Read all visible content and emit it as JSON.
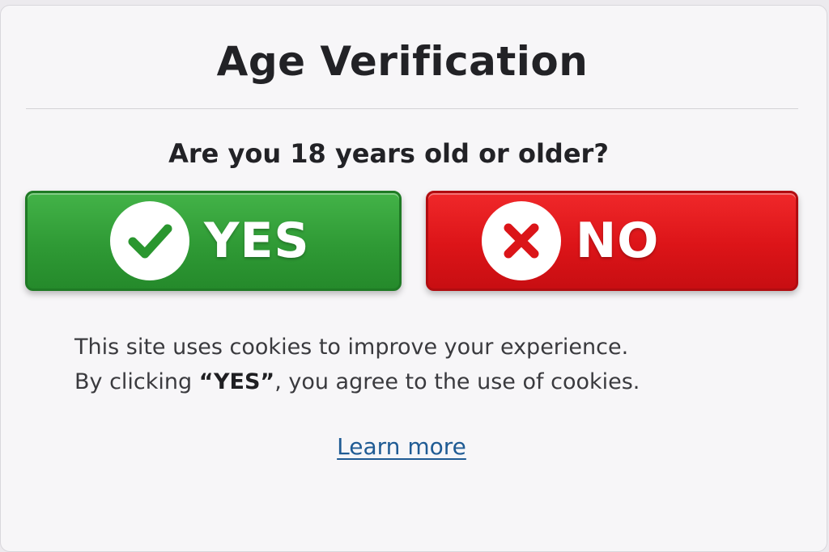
{
  "dialog": {
    "title": "Age Verification",
    "question": "Are you 18 years old or older?"
  },
  "buttons": {
    "yes": {
      "label": "YES",
      "icon": "check-icon",
      "color": "#2f9a35"
    },
    "no": {
      "label": "NO",
      "icon": "x-icon",
      "color": "#dc1418"
    }
  },
  "notice": {
    "line1": "This site uses cookies to improve your experience.",
    "line2_prefix": "By clicking ",
    "line2_bold": "“YES”",
    "line2_suffix": ", you agree to the use of cookies."
  },
  "link": {
    "label": "Learn more",
    "color": "#1f5b94"
  }
}
